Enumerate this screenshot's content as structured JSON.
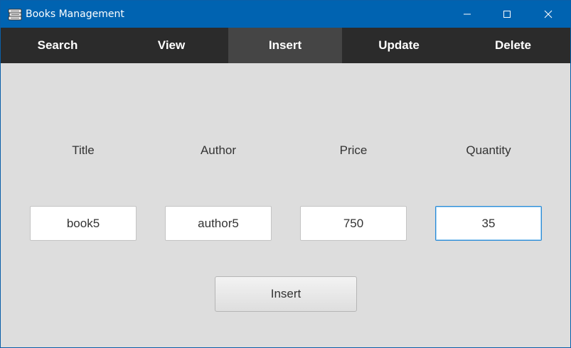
{
  "window": {
    "title": "Books Management",
    "icon": "books-stack-icon",
    "controls": [
      "minimize-icon",
      "maximize-icon",
      "close-icon"
    ],
    "colors": {
      "titlebar": "#0063b1",
      "tabbar": "#2b2b2b",
      "tab_active": "#454545",
      "body": "#dddddd",
      "focus_border": "#2b8bd6"
    }
  },
  "tabs": [
    {
      "label": "Search",
      "active": false
    },
    {
      "label": "View",
      "active": false
    },
    {
      "label": "Insert",
      "active": true
    },
    {
      "label": "Update",
      "active": false
    },
    {
      "label": "Delete",
      "active": false
    }
  ],
  "form": {
    "fields": [
      {
        "label": "Title",
        "value": "book5"
      },
      {
        "label": "Author",
        "value": "author5"
      },
      {
        "label": "Price",
        "value": "750"
      },
      {
        "label": "Quantity",
        "value": "35",
        "focused": true
      }
    ],
    "submit_label": "Insert"
  }
}
